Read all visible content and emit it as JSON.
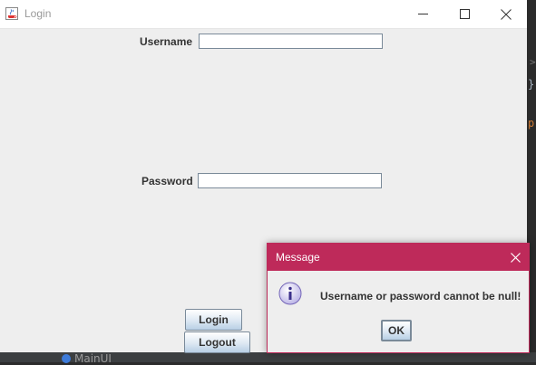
{
  "login_window": {
    "title": "Login",
    "username_label": "Username",
    "username_value": "",
    "password_label": "Password",
    "password_value": "",
    "login_button": "Login",
    "logout_button": "Logout"
  },
  "message_dialog": {
    "title": "Message",
    "message": "Username or password cannot be null!",
    "ok_button": "OK",
    "accent_color": "#be2a5a"
  },
  "background_ide": {
    "file_label": "MainUI",
    "brace": "}",
    "fragment": "p"
  }
}
